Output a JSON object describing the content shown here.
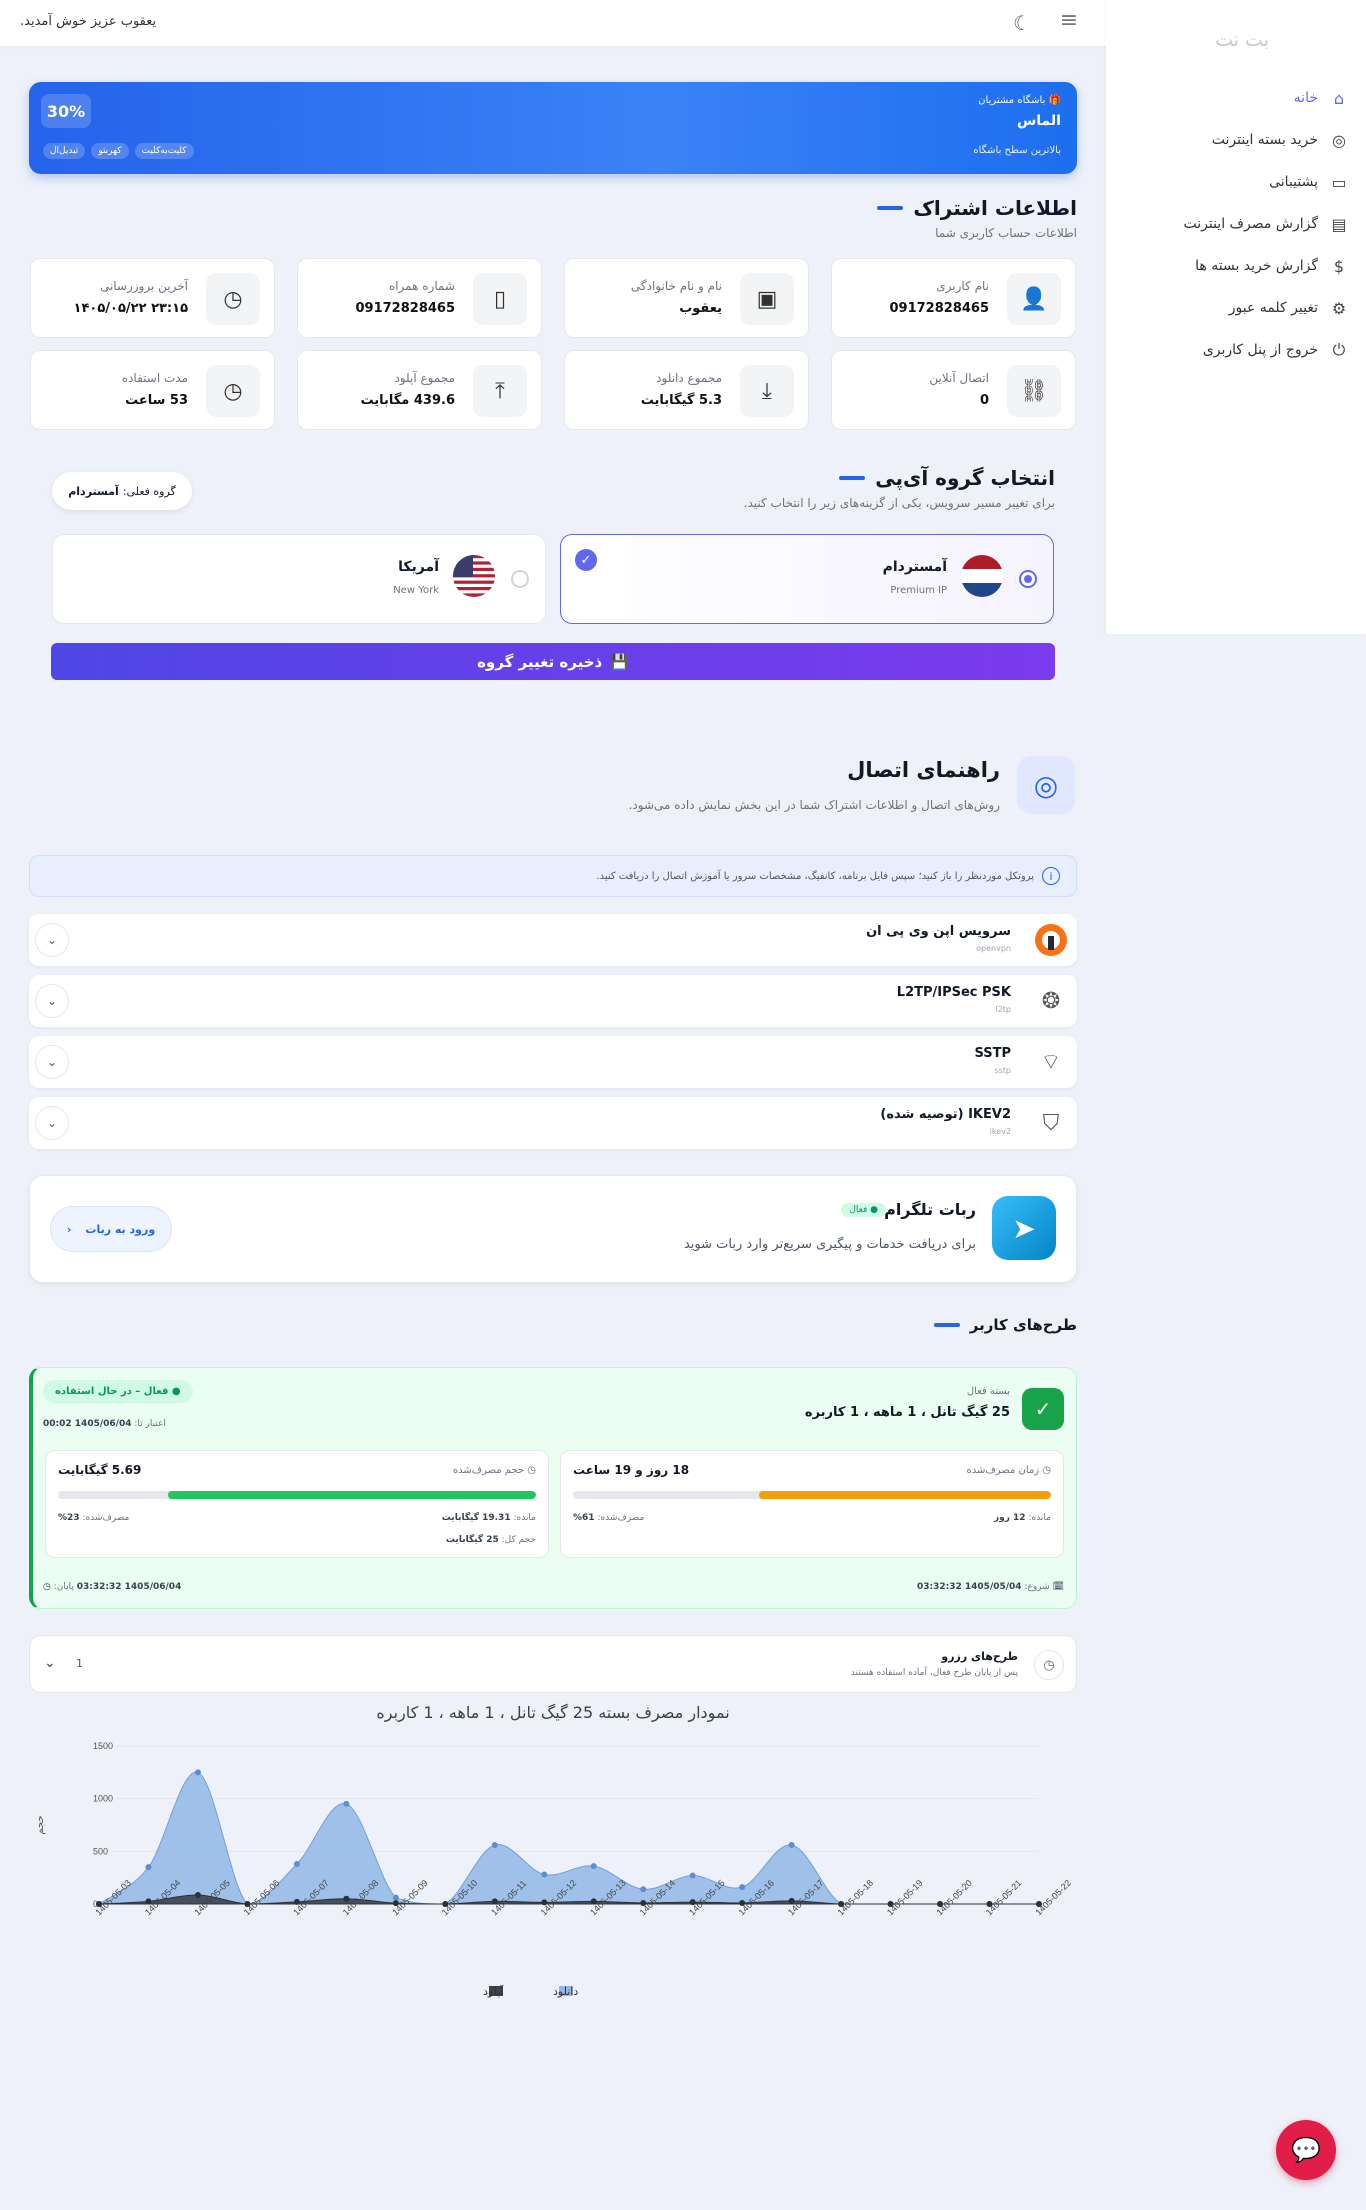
{
  "topbar": {
    "welcome": "یعقوب عزیز خوش آمدید.",
    "menu_icon": "hamburger-icon",
    "theme_icon": "moon-icon"
  },
  "sidebar": {
    "brand": "بت نت",
    "items": [
      {
        "label": "خانه",
        "icon": "home-icon",
        "active": true
      },
      {
        "label": "خرید بسته اینترنت",
        "icon": "globe-icon"
      },
      {
        "label": "پشتیبانی",
        "icon": "chat-icon"
      },
      {
        "label": "گزارش مصرف اینترنت",
        "icon": "report-icon"
      },
      {
        "label": "گزارش خرید بسته ها",
        "icon": "dollar-icon"
      },
      {
        "label": "تغییر کلمه عبور",
        "icon": "gear-icon"
      },
      {
        "label": "خروج از پنل کاربری",
        "icon": "power-icon"
      }
    ]
  },
  "hero": {
    "club": "باشگاه مشتریان",
    "level": "الماس",
    "sub": "بالاترین سطح باشگاه",
    "percent": "30%",
    "tags": [
      "تبدیل‌ال",
      "کهربتو",
      "کلیت‌به‌کلیت"
    ]
  },
  "subscription": {
    "title": "اطلاعات اشتراک",
    "subtitle": "اطلاعات حساب کاربری شما",
    "cards": [
      {
        "label": "نام کاربری",
        "value": "09172828465",
        "icon": "user-icon"
      },
      {
        "label": "نام و نام خانوادگی",
        "value": "یعقوب",
        "icon": "id-card-icon"
      },
      {
        "label": "شماره همراه",
        "value": "09172828465",
        "icon": "phone-icon"
      },
      {
        "label": "آخرین بروزرسانی",
        "value": "۲۳:۱۵ ۱۴۰۵/۰۵/۲۲",
        "icon": "clock-icon"
      },
      {
        "label": "اتصال آنلاین",
        "value": "0",
        "icon": "link-icon"
      },
      {
        "label": "مجموع دانلود",
        "value": "5.3 گیگابایت",
        "icon": "download-icon"
      },
      {
        "label": "مجموع آپلود",
        "value": "439.6 مگابایت",
        "icon": "upload-icon"
      },
      {
        "label": "مدت استفاده",
        "value": "53 ساعت",
        "icon": "clock-icon"
      }
    ]
  },
  "ip_group": {
    "title": "انتخاب گروه آی‌پی",
    "subtitle": "برای تغییر مسیر سرویس، یکی از گزینه‌های زیر را انتخاب کنید.",
    "current_label": "گروه فعلی:",
    "current_value": "آمستردام",
    "servers": [
      {
        "name": "آمستردام",
        "tier": "Premium IP",
        "selected": true
      },
      {
        "name": "آمریکا",
        "tier": "New York",
        "selected": false
      }
    ],
    "save_label": "ذخیره تغییر گروه"
  },
  "guide": {
    "title": "راهنمای اتصال",
    "subtitle": "روش‌های اتصال و اطلاعات اشتراک شما در این بخش نمایش داده می‌شود.",
    "info": "پروتکل موردنظر را باز کنید؛ سپس فایل برنامه، کانفیگ، مشخصات سرور یا آموزش اتصال را دریافت کنید.",
    "protocols": [
      {
        "name": "سرویس اپن وی پی ان",
        "code": "openvpn",
        "icon": "openvpn-icon"
      },
      {
        "name": "L2TP/IPSec PSK",
        "code": "l2tp",
        "icon": "network-icon"
      },
      {
        "name": "SSTP",
        "code": "sstp",
        "icon": "wifi-lock-icon"
      },
      {
        "name": "IKEV2 (توصیه شده)",
        "code": "ikev2",
        "icon": "shield-bolt-icon"
      }
    ]
  },
  "bot": {
    "title": "ربات تلگرام",
    "badge": "فعال",
    "desc": "برای دریافت خدمات و پیگیری سریع‌تر وارد ربات شوید",
    "button": "ورود به ربات"
  },
  "plans": {
    "title": "طرح‌های کاربر",
    "active": {
      "label": "بسته فعال",
      "name": "25 گیگ تانل ، 1 ماهه ، 1 کاربره",
      "status": "فعال – در حال استفاده",
      "expiry_label": "اعتبار تا:",
      "expiry": "1405/06/04 00:02",
      "time": {
        "label": "زمان مصرف‌شده",
        "value": "18 روز و 19 ساعت",
        "remaining_label": "مانده:",
        "remaining": "12 روز",
        "used_label": "مصرف‌شده:",
        "used": "61%",
        "fraction": 0.61
      },
      "volume": {
        "label": "حجم مصرف‌شده",
        "value": "5.69 گیگابایت",
        "remaining_label": "مانده:",
        "remaining": "19.31 گیگابایت",
        "used_label": "مصرف‌شده:",
        "used": "23%",
        "total_label": "حجم کل:",
        "total": "25 گیگابایت",
        "fraction": 0.77
      },
      "start_label": "شروع:",
      "start": "1405/05/04 03:32:32",
      "end_label": "پایان:",
      "end": "1405/06/04 03:32:32"
    },
    "reserve": {
      "title": "طرح‌های رزرو",
      "desc": "پس از پایان طرح فعال، آماده استفاده هستند",
      "count": "1"
    }
  },
  "chart_title": "نمودار مصرف بسته 25 گیگ تانل ، 1 ماهه ، 1 کاربره",
  "chart_data": {
    "type": "area",
    "title": "نمودار مصرف بسته 25 گیگ تانل ، 1 ماهه ، 1 کاربره",
    "ylabel": "حجم",
    "xlabel": "",
    "ylim": [
      0,
      1500
    ],
    "yticks": [
      0,
      500,
      1000,
      1500
    ],
    "x": [
      "1405-05-03",
      "1405-05-04",
      "1405-05-05",
      "1405-05-06",
      "1405-05-07",
      "1405-05-08",
      "1405-05-09",
      "1405-05-10",
      "1405-05-11",
      "1405-05-12",
      "1405-05-13",
      "1405-05-14",
      "1405-05-15",
      "1405-05-16",
      "1405-05-17",
      "1405-05-18",
      "1405-05-19",
      "1405-05-20",
      "1405-05-21",
      "1405-05-22"
    ],
    "series": [
      {
        "name": "دانلود",
        "color": "#90b8e6",
        "values": [
          0,
          350,
          1250,
          0,
          380,
          950,
          60,
          0,
          560,
          280,
          360,
          140,
          270,
          160,
          560,
          0,
          0,
          0,
          0,
          0
        ]
      },
      {
        "name": "آپلود",
        "color": "#3d4350",
        "values": [
          0,
          25,
          85,
          0,
          20,
          50,
          8,
          0,
          25,
          15,
          25,
          10,
          18,
          10,
          30,
          0,
          0,
          0,
          0,
          0
        ]
      }
    ],
    "legend": "bottom"
  },
  "colors": {
    "accent": "#6366f1",
    "primary": "#2563eb",
    "success": "#16a34a",
    "warning": "#f59e0b"
  }
}
